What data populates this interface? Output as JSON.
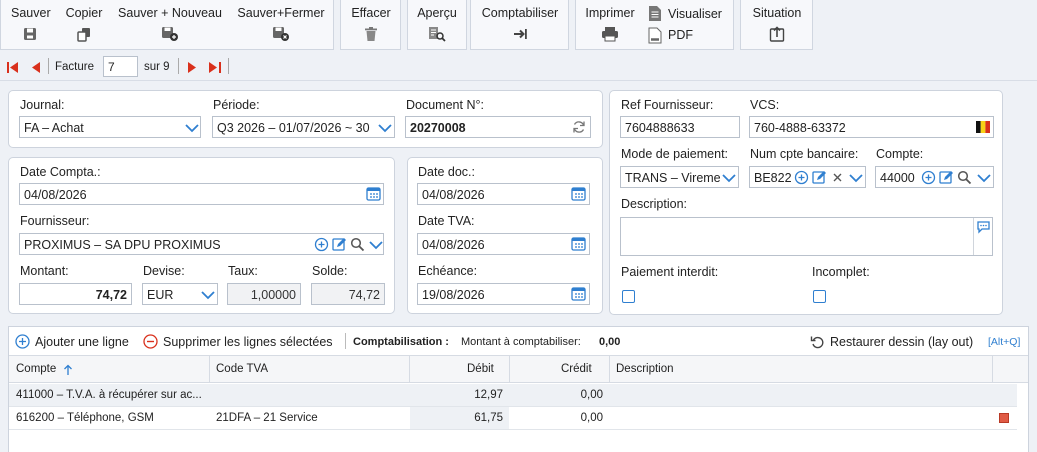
{
  "toolbar": {
    "save": "Sauver",
    "copy": "Copier",
    "save_new": "Sauver + Nouveau",
    "save_close": "Sauver+Fermer",
    "delete": "Effacer",
    "preview": "Aperçu",
    "post": "Comptabiliser",
    "print": "Imprimer",
    "view": "Visualiser",
    "pdf": "PDF",
    "status": "Situation"
  },
  "nav": {
    "label": "Facture",
    "current": "7",
    "of": "sur 9"
  },
  "header": {
    "journal_label": "Journal:",
    "journal_value": "FA – Achat",
    "period_label": "Période:",
    "period_value": "Q3 2026 – 01/07/2026 ~ 30",
    "docno_label": "Document N°:",
    "docno_value": "20270008",
    "date_compta_label": "Date Compta.:",
    "date_compta_value": "04/08/2026",
    "supplier_label": "Fournisseur:",
    "supplier_value": "PROXIMUS – SA DPU PROXIMUS",
    "amount_label": "Montant:",
    "amount_value": "74,72",
    "currency_label": "Devise:",
    "currency_value": "EUR",
    "rate_label": "Taux:",
    "rate_value": "1,00000",
    "balance_label": "Solde:",
    "balance_value": "74,72",
    "date_doc_label": "Date doc.:",
    "date_doc_value": "04/08/2026",
    "date_tva_label": "Date TVA:",
    "date_tva_value": "04/08/2026",
    "due_label": "Echéance:",
    "due_value": "19/08/2026",
    "ref_supplier_label": "Ref Fournisseur:",
    "ref_supplier_value": "7604888633",
    "vcs_label": "VCS:",
    "vcs_value": "760-4888-63372",
    "payment_mode_label": "Mode de paiement:",
    "payment_mode_value": "TRANS – Vireme",
    "bank_label": "Num cpte bancaire:",
    "bank_value": "BE822",
    "account_label": "Compte:",
    "account_value": "44000",
    "description_label": "Description:",
    "description_value": "",
    "payment_blocked_label": "Paiement interdit:",
    "incomplete_label": "Incomplet:"
  },
  "grid_toolbar": {
    "add_line": "Ajouter une ligne",
    "delete_lines": "Supprimer les lignes sélectées",
    "posting_label": "Comptabilisation :",
    "amount_to_post_label": "Montant à comptabiliser:",
    "amount_to_post_value": "0,00",
    "restore_layout": "Restaurer dessin (lay out)",
    "shortcut": "[Alt+Q]"
  },
  "grid": {
    "columns": [
      "Compte",
      "Code TVA",
      "Débit",
      "Crédit",
      "Description"
    ],
    "rows": [
      {
        "compte": "411000 – T.V.A. à récupérer sur ac...",
        "code_tva": "",
        "debit": "12,97",
        "credit": "0,00",
        "description": ""
      },
      {
        "compte": "616200 – Téléphone, GSM",
        "code_tva": "21DFA – 21 Service",
        "debit": "61,75",
        "credit": "0,00",
        "description": ""
      }
    ]
  },
  "colors": {
    "accent": "#2f7fd0",
    "nav_red": "#d9301c",
    "delete_red": "#d9301c"
  }
}
